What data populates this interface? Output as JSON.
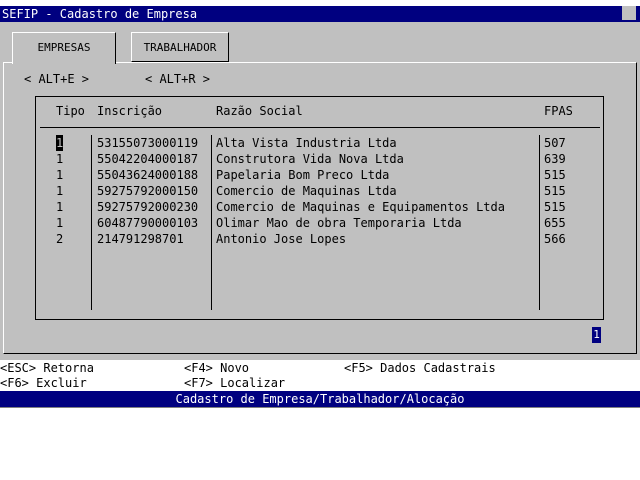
{
  "window": {
    "title": "SEFIP - Cadastro de Empresa"
  },
  "tabs": [
    {
      "label": "EMPRESAS"
    },
    {
      "label": "TRABALHADOR"
    }
  ],
  "hotkeys": {
    "empresas": "< ALT+E >",
    "trabalhador": "< ALT+R >"
  },
  "table": {
    "headers": {
      "tipo": "Tipo",
      "inscricao": "Inscrição",
      "razao": "Razão Social",
      "fpas": "FPAS"
    },
    "rows": [
      {
        "tipo": "1",
        "inscricao": "53155073000119",
        "razao": "Alta Vista Industria Ltda",
        "fpas": "507"
      },
      {
        "tipo": "1",
        "inscricao": "55042204000187",
        "razao": "Construtora Vida Nova Ltda",
        "fpas": "639"
      },
      {
        "tipo": "1",
        "inscricao": "55043624000188",
        "razao": "Papelaria Bom Preco Ltda",
        "fpas": "515"
      },
      {
        "tipo": "1",
        "inscricao": "59275792000150",
        "razao": "Comercio de Maquinas Ltda",
        "fpas": "515"
      },
      {
        "tipo": "1",
        "inscricao": "59275792000230",
        "razao": "Comercio de Maquinas e Equipamentos Ltda",
        "fpas": "515"
      },
      {
        "tipo": "1",
        "inscricao": "60487790000103",
        "razao": "Olimar Mao de obra Temporaria Ltda",
        "fpas": "655"
      },
      {
        "tipo": "2",
        "inscricao": "214791298701",
        "razao": "Antonio Jose Lopes",
        "fpas": "566"
      }
    ]
  },
  "page_indicator": "1",
  "function_keys": {
    "esc": "<ESC> Retorna",
    "f4": "<F4> Novo",
    "f5": "<F5> Dados Cadastrais",
    "f6": "<F6> Excluir",
    "f7": "<F7> Localizar"
  },
  "statusbar": {
    "text": "Cadastro de Empresa/Trabalhador/Alocação"
  }
}
